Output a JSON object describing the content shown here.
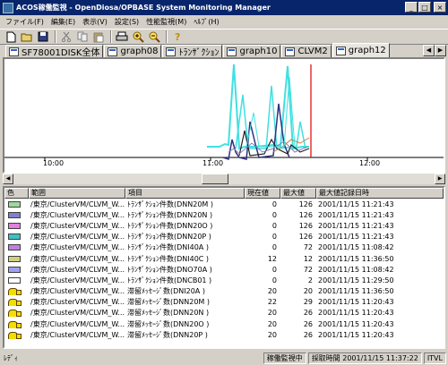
{
  "window": {
    "title": "ACOS稼働監視 - OpenDiosa/OPBASE System Monitoring Manager"
  },
  "window_buttons": {
    "minimize": "_",
    "maximize": "□",
    "close": "×"
  },
  "menu": [
    {
      "label": "ファイル(F)"
    },
    {
      "label": "編集(E)"
    },
    {
      "label": "表示(V)"
    },
    {
      "label": "設定(S)"
    },
    {
      "label": "性能監視(M)"
    },
    {
      "label": "ﾍﾙﾌﾟ(H)"
    }
  ],
  "toolbar": {
    "icons": [
      "new-icon",
      "open-icon",
      "save-icon",
      "cut-icon",
      "copy-icon",
      "paste-icon",
      "print-icon",
      "zoom-in-icon",
      "zoom-out-icon",
      "help-icon"
    ]
  },
  "tabs": [
    {
      "label": "SF78001DISK全体",
      "active": false
    },
    {
      "label": "graph08",
      "active": false
    },
    {
      "label": "ﾄﾗﾝｻﾞｸｼｮﾝ",
      "active": false
    },
    {
      "label": "graph10",
      "active": false
    },
    {
      "label": "CLVM2",
      "active": false
    },
    {
      "label": "graph12",
      "active": true
    }
  ],
  "chart_data": {
    "type": "line",
    "x_ticks": [
      "10:00",
      "11:00",
      "12:00"
    ],
    "cursor_color": "#e00000",
    "series_colors": [
      "#40e0e0",
      "#40e0e0",
      "#303080",
      "#202020",
      "#8080c0",
      "#c08040",
      "#40e0e0"
    ]
  },
  "list": {
    "columns": [
      "色",
      "範囲",
      "項目",
      "現在値",
      "最大値",
      "最大値記録日時"
    ],
    "rows": [
      {
        "icon": "swatch",
        "color": "#9cd99c",
        "scope": "/東京/ClusterVM/CLVM_W...",
        "item": "ﾄﾗﾝｻﾞｸｼｮﾝ件数(DNN20M )",
        "current": "0",
        "max": "126",
        "datetime": "2001/11/15 11:21:43"
      },
      {
        "icon": "swatch",
        "color": "#8080d0",
        "scope": "/東京/ClusterVM/CLVM_W...",
        "item": "ﾄﾗﾝｻﾞｸｼｮﾝ件数(DNN20N )",
        "current": "0",
        "max": "126",
        "datetime": "2001/11/15 11:21:43"
      },
      {
        "icon": "swatch",
        "color": "#e080e0",
        "scope": "/東京/ClusterVM/CLVM_W...",
        "item": "ﾄﾗﾝｻﾞｸｼｮﾝ件数(DNN20O )",
        "current": "0",
        "max": "126",
        "datetime": "2001/11/15 11:21:43"
      },
      {
        "icon": "swatch",
        "color": "#40c0c0",
        "scope": "/東京/ClusterVM/CLVM_W...",
        "item": "ﾄﾗﾝｻﾞｸｼｮﾝ件数(DNN20P )",
        "current": "0",
        "max": "126",
        "datetime": "2001/11/15 11:21:43"
      },
      {
        "icon": "swatch",
        "color": "#c080e0",
        "scope": "/東京/ClusterVM/CLVM_W...",
        "item": "ﾄﾗﾝｻﾞｸｼｮﾝ件数(DNI40A )",
        "current": "0",
        "max": "72",
        "datetime": "2001/11/15 11:08:42"
      },
      {
        "icon": "swatch",
        "color": "#d0d080",
        "scope": "/東京/ClusterVM/CLVM_W...",
        "item": "ﾄﾗﾝｻﾞｸｼｮﾝ件数(DNI40C )",
        "current": "12",
        "max": "12",
        "datetime": "2001/11/15 11:36:50"
      },
      {
        "icon": "swatch",
        "color": "#a0a0f0",
        "scope": "/東京/ClusterVM/CLVM_W...",
        "item": "ﾄﾗﾝｻﾞｸｼｮﾝ件数(DNO70A )",
        "current": "0",
        "max": "72",
        "datetime": "2001/11/15 11:08:42"
      },
      {
        "icon": "swatch",
        "color": "#ffffff",
        "scope": "/東京/ClusterVM/CLVM_W...",
        "item": "ﾄﾗﾝｻﾞｸｼｮﾝ件数(DNCB01 )",
        "current": "0",
        "max": "2",
        "datetime": "2001/11/15 11:29:50"
      },
      {
        "icon": "alarm",
        "color": "#f0e000",
        "scope": "/東京/ClusterVM/CLVM_W...",
        "item": "滞留ﾒｯｾｰｼﾞ数(DNI20A )",
        "current": "20",
        "max": "20",
        "datetime": "2001/11/15 11:36:50"
      },
      {
        "icon": "alarm",
        "color": "#f0e000",
        "scope": "/東京/ClusterVM/CLVM_W...",
        "item": "滞留ﾒｯｾｰｼﾞ数(DNN20M )",
        "current": "22",
        "max": "29",
        "datetime": "2001/11/15 11:20:43"
      },
      {
        "icon": "alarm",
        "color": "#f0e000",
        "scope": "/東京/ClusterVM/CLVM_W...",
        "item": "滞留ﾒｯｾｰｼﾞ数(DNN20N )",
        "current": "20",
        "max": "26",
        "datetime": "2001/11/15 11:20:43"
      },
      {
        "icon": "alarm",
        "color": "#f0e000",
        "scope": "/東京/ClusterVM/CLVM_W...",
        "item": "滞留ﾒｯｾｰｼﾞ数(DNN20O )",
        "current": "20",
        "max": "26",
        "datetime": "2001/11/15 11:20:43"
      },
      {
        "icon": "alarm",
        "color": "#f0e000",
        "scope": "/東京/ClusterVM/CLVM_W...",
        "item": "滞留ﾒｯｾｰｼﾞ数(DNN20P )",
        "current": "20",
        "max": "26",
        "datetime": "2001/11/15 11:20:43"
      }
    ]
  },
  "status": {
    "ready": "ﾚﾃﾞｨ",
    "monitoring": "稼働監視中",
    "collect_time": "採取時間 2001/11/15 11:37:22",
    "interval": "ITVL"
  }
}
